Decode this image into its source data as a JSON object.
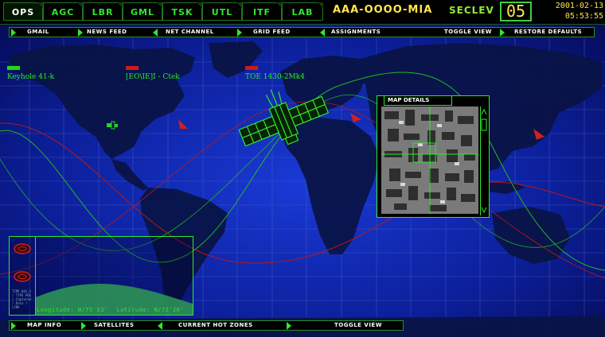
{
  "top_tabs": [
    {
      "label": "OPS",
      "active": true
    },
    {
      "label": "AGC"
    },
    {
      "label": "LBR"
    },
    {
      "label": "GML"
    },
    {
      "label": "TSK"
    },
    {
      "label": "UTL"
    },
    {
      "label": "ITF"
    },
    {
      "label": "LAB"
    }
  ],
  "agent_id": "AAA-OOOO-MIA",
  "seclev": {
    "label": "SECLEV",
    "value": "05"
  },
  "datetime": {
    "date": "2001-02-13",
    "time": "05:53:55"
  },
  "toolbar": {
    "gmail": "GMAIL",
    "news_feed": "NEWS FEED",
    "net_channel": "NET CHANNEL",
    "grid_feed": "GRID FEED",
    "assignments": "ASSIGNMENTS",
    "toggle_view": "TOGGLE VIEW",
    "restore_defaults": "RESTORE DEFAULTS"
  },
  "satellites": [
    {
      "label": "Keyhole 41-k",
      "color": "#1fd81f"
    },
    {
      "label": "[EO\\IE]I - Ctek",
      "color": "#cc1a1a"
    },
    {
      "label": "TOE 1430-2Mk4",
      "color": "#cc1a1a"
    }
  ],
  "map_details": {
    "title": "MAP DETAILS"
  },
  "info_panel": {
    "longitude_label": "Longitude:",
    "longitude": "W/75'53'",
    "latitude_label": "Latitude:",
    "latitude": "N/72'26'",
    "side_text": "TIME 001.3 / TYPE PDG / Captured / Data / LINK"
  },
  "bottom_toolbar": {
    "map_info": "MAP INFO",
    "satellites": "SATELLITES",
    "current_hot_zones": "CURRENT HOT ZONES",
    "toggle_view": "TOGGLE VIEW"
  },
  "colors": {
    "green": "#2ee82e",
    "yellow": "#ffe84d",
    "red": "#cc1a1a",
    "ocean": "#061062"
  }
}
